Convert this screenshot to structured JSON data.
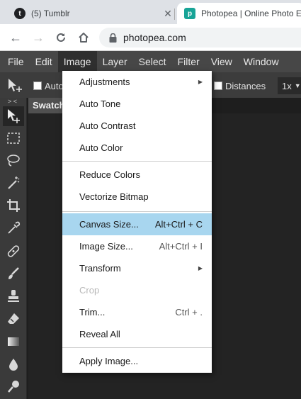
{
  "browser": {
    "tabs": [
      {
        "title": "(5) Tumblr",
        "favicon": "tumblr-icon",
        "active": false
      },
      {
        "title": "Photopea | Online Photo Editor",
        "favicon": "photopea-icon",
        "active": true
      }
    ],
    "url": "photopea.com"
  },
  "app": {
    "menu": [
      "File",
      "Edit",
      "Image",
      "Layer",
      "Select",
      "Filter",
      "View",
      "Window"
    ],
    "options": {
      "auto_label": "Auto",
      "distances_label": "Distances",
      "zoom": "1x"
    },
    "panel_tab": "Swatches",
    "collapse_glyph": "> <"
  },
  "image_menu": {
    "groups": [
      [
        {
          "label": "Adjustments",
          "submenu": true
        },
        {
          "label": "Auto Tone"
        },
        {
          "label": "Auto Contrast"
        },
        {
          "label": "Auto Color"
        }
      ],
      [
        {
          "label": "Reduce Colors"
        },
        {
          "label": "Vectorize Bitmap"
        }
      ],
      [
        {
          "label": "Canvas Size...",
          "shortcut": "Alt+Ctrl + C",
          "highlighted": true
        },
        {
          "label": "Image Size...",
          "shortcut": "Alt+Ctrl + I"
        },
        {
          "label": "Transform",
          "submenu": true
        },
        {
          "label": "Crop",
          "disabled": true
        },
        {
          "label": "Trim...",
          "shortcut": "Ctrl + ."
        },
        {
          "label": "Reveal All"
        }
      ],
      [
        {
          "label": "Apply Image..."
        }
      ]
    ]
  },
  "colors": {
    "menubar": "#474747",
    "highlight": "#a8d6ef",
    "photopea_brand": "#18a497"
  }
}
